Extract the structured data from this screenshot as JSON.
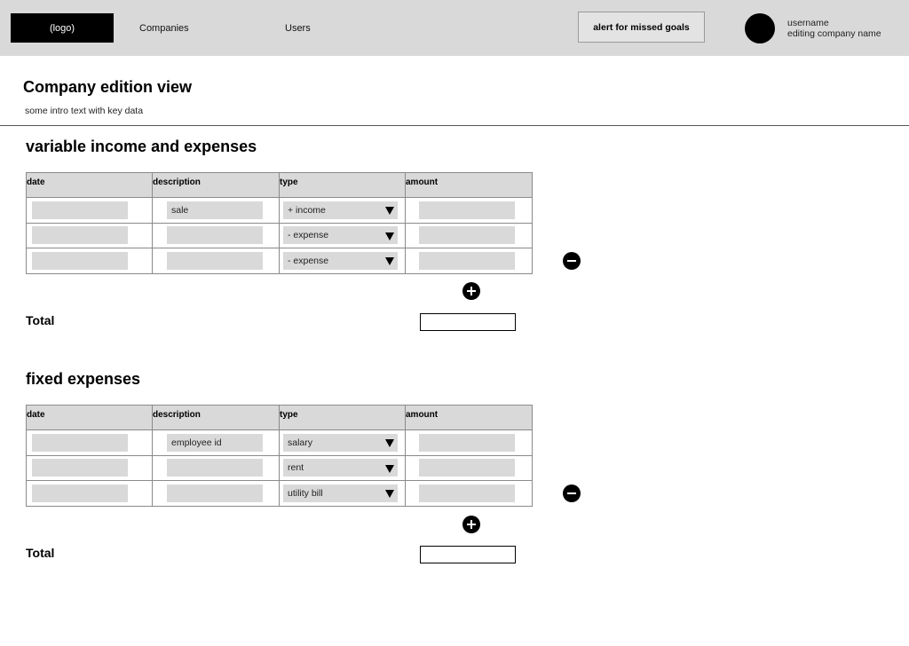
{
  "header": {
    "logo": "(logo)",
    "nav": {
      "companies": "Companies",
      "users": "Users"
    },
    "alert_button": "alert for missed goals",
    "user": {
      "name": "username",
      "company": "editing company name"
    }
  },
  "page": {
    "title": "Company edition view",
    "intro": "some intro text with key data"
  },
  "variable": {
    "title": "variable income and expenses",
    "columns": [
      "date",
      "description",
      "type",
      "amount"
    ],
    "rows": [
      {
        "date": "",
        "description": "sale",
        "type": "+ income",
        "amount": ""
      },
      {
        "date": "",
        "description": "",
        "type": "- expense",
        "amount": ""
      },
      {
        "date": "",
        "description": "",
        "type": "- expense",
        "amount": ""
      }
    ],
    "total_label": "Total",
    "total_value": ""
  },
  "fixed": {
    "title": "fixed expenses",
    "columns": [
      "date",
      "description",
      "type",
      "amount"
    ],
    "rows": [
      {
        "date": "",
        "description": "employee id",
        "type": "salary",
        "amount": ""
      },
      {
        "date": "",
        "description": "",
        "type": "rent",
        "amount": ""
      },
      {
        "date": "",
        "description": "",
        "type": "utility bill",
        "amount": ""
      }
    ],
    "total_label": "Total",
    "total_value": ""
  },
  "icons": {
    "remove_row": "minus-circle-icon",
    "add_row": "plus-circle-icon",
    "dropdown": "caret-down-icon"
  },
  "colors": {
    "header_bg": "#d9d9d9",
    "field_bg": "#d9d9d9",
    "accent": "#000000"
  }
}
